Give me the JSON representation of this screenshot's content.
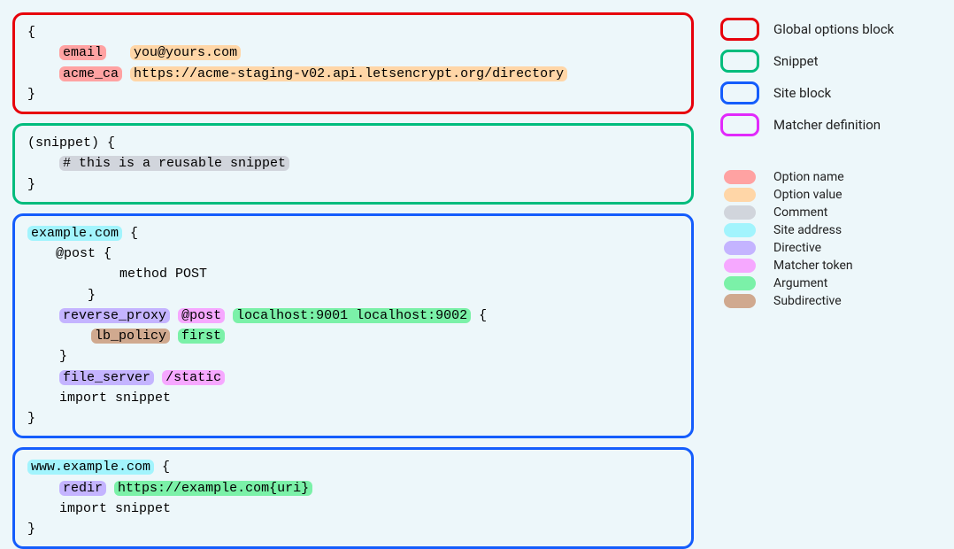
{
  "blocks": {
    "global": {
      "open": "{",
      "email_key": "email",
      "email_val": "you@yours.com",
      "ca_key": "acme_ca",
      "ca_val": "https://acme-staging-v02.api.letsencrypt.org/directory",
      "close": "}"
    },
    "snippet": {
      "head": "(snippet) {",
      "comment": "# this is a reusable snippet",
      "close": "}"
    },
    "site1": {
      "addr": "example.com",
      "open": " {",
      "matcher_open": "@post {",
      "matcher_line": "        method POST",
      "matcher_close": "    }",
      "rp_dir": "reverse_proxy",
      "rp_matcher": "@post",
      "rp_args": "localhost:9001 localhost:9002",
      "rp_brace": " {",
      "lb_sub": "lb_policy",
      "lb_arg": "first",
      "rp_close": "    }",
      "fs_dir": "file_server",
      "fs_matcher": "/static",
      "import_line": "    import snippet",
      "close": "}"
    },
    "site2": {
      "addr": "www.example.com",
      "open": " {",
      "redir_dir": "redir",
      "redir_arg": "https://example.com{uri}",
      "import_line": "    import snippet",
      "close": "}"
    }
  },
  "legend": {
    "borders": [
      {
        "color": "#e7000b",
        "label": "Global options block"
      },
      {
        "color": "#00bc7d",
        "label": "Snippet"
      },
      {
        "color": "#155dfc",
        "label": "Site block"
      },
      {
        "color": "#e12afb",
        "label": "Matcher definition"
      }
    ],
    "pills": [
      {
        "cls": "option-name",
        "label": "Option name"
      },
      {
        "cls": "option-value",
        "label": "Option value"
      },
      {
        "cls": "comment",
        "label": "Comment"
      },
      {
        "cls": "site-addr",
        "label": "Site address"
      },
      {
        "cls": "directive",
        "label": "Directive"
      },
      {
        "cls": "matcher",
        "label": "Matcher token"
      },
      {
        "cls": "argument",
        "label": "Argument"
      },
      {
        "cls": "subdir",
        "label": "Subdirective"
      }
    ]
  }
}
